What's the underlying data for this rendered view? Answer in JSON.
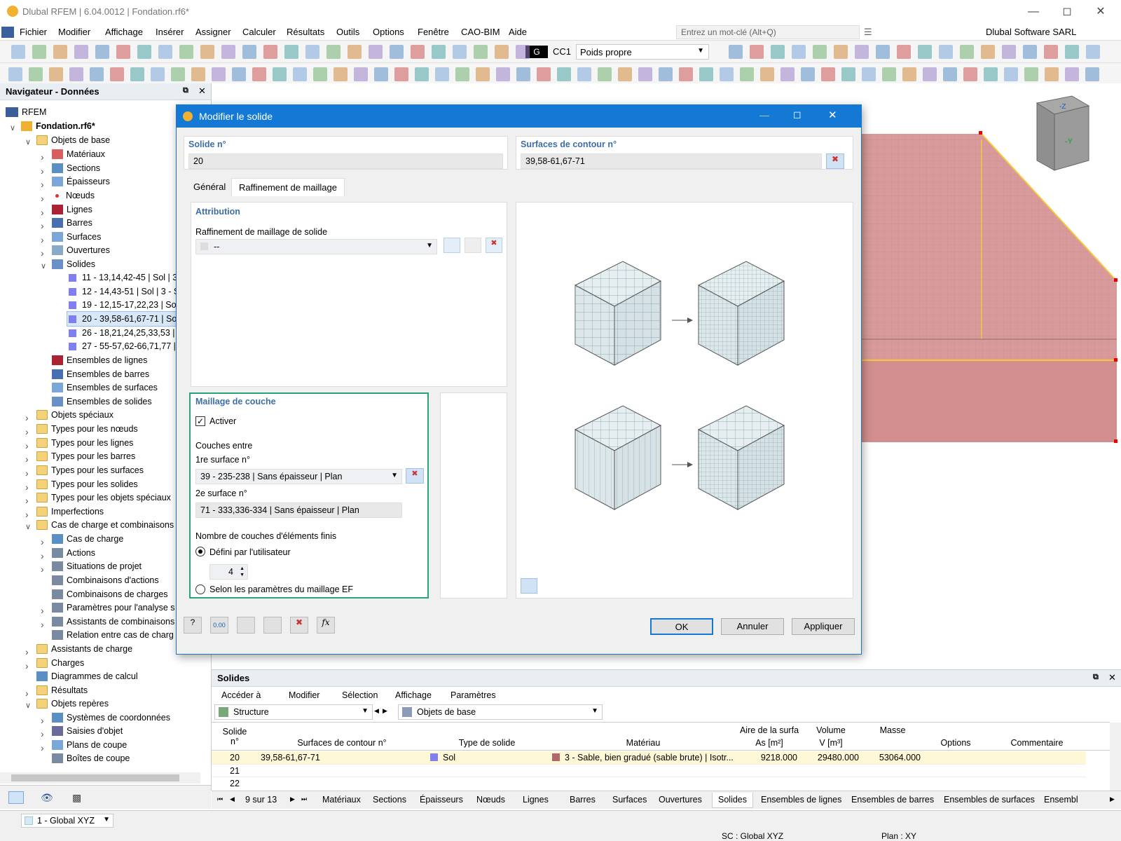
{
  "window": {
    "title": "Dlubal RFEM | 6.04.0012 | Fondation.rf6*",
    "company": "Dlubal Software SARL"
  },
  "menu": [
    "Fichier",
    "Modifier",
    "Affichage",
    "Insérer",
    "Assigner",
    "Calculer",
    "Résultats",
    "Outils",
    "Options",
    "Fenêtre",
    "CAO-BIM",
    "Aide"
  ],
  "search": {
    "placeholder": "Entrez un mot-clé (Alt+Q)"
  },
  "toolbar": {
    "lc_badge": "G",
    "lc_code": "CC1",
    "lc_name": "Poids propre"
  },
  "navigator": {
    "title": "Navigateur - Données",
    "root": "RFEM",
    "file": "Fondation.rf6*",
    "items": [
      "Objets de base",
      "Matériaux",
      "Sections",
      "Épaisseurs",
      "Nœuds",
      "Lignes",
      "Barres",
      "Surfaces",
      "Ouvertures",
      "Solides",
      "11 - 13,14,42-45 | Sol | 3",
      "12 - 14,43-51 | Sol | 3 - S",
      "19 - 12,15-17,22,23 | Sol",
      "20 - 39,58-61,67-71 | Sol",
      "26 - 18,21,24,25,33,53 | S",
      "27 - 55-57,62-66,71,77 | S",
      "Ensembles de lignes",
      "Ensembles de barres",
      "Ensembles de surfaces",
      "Ensembles de solides",
      "Objets spéciaux",
      "Types pour les nœuds",
      "Types pour les lignes",
      "Types pour les barres",
      "Types pour les surfaces",
      "Types pour les solides",
      "Types pour les objets spéciaux",
      "Imperfections",
      "Cas de charge et combinaisons",
      "Cas de charge",
      "Actions",
      "Situations de projet",
      "Combinaisons d'actions",
      "Combinaisons de charges",
      "Paramètres pour l'analyse s",
      "Assistants de combinaisons",
      "Relation entre cas de charg",
      "Assistants de charge",
      "Charges",
      "Diagrammes de calcul",
      "Résultats",
      "Objets repères",
      "Systèmes de coordonnées",
      "Saisies d'objet",
      "Plans de coupe",
      "Boîtes de coupe"
    ]
  },
  "viewcube": {
    "top": "-Z",
    "front": "-Y"
  },
  "dialog": {
    "title": "Modifier le solide",
    "solid_no_label": "Solide n°",
    "solid_no": "20",
    "boundary_label": "Surfaces de contour n°",
    "boundary": "39,58-61,67-71",
    "tabs": [
      "Général",
      "Raffinement de maillage"
    ],
    "attribution": "Attribution",
    "refinement_label": "Raffinement de maillage de solide",
    "refinement_value": "--",
    "layer_title": "Maillage de couche",
    "activate": "Activer",
    "layers_between": "Couches entre",
    "first_surface_label": "1re surface n°",
    "first_surface": "39 - 235-238 | Sans épaisseur | Plan",
    "second_surface_label": "2e surface n°",
    "second_surface": "71 - 333,336-334 | Sans épaisseur | Plan",
    "count_label": "Nombre de couches d'éléments finis",
    "user_defined": "Défini par l'utilisateur",
    "count": "4",
    "by_mesh": "Selon les paramètres du maillage EF",
    "ok": "OK",
    "cancel": "Annuler",
    "apply": "Appliquer"
  },
  "solids_panel": {
    "title": "Solides",
    "menu": [
      "Accéder à",
      "Modifier",
      "Sélection",
      "Affichage",
      "Paramètres"
    ],
    "filter1": "Structure",
    "filter2": "Objets de base",
    "headers": {
      "no": "Solide n°",
      "boundary": "Surfaces de contour n°",
      "type": "Type de solide",
      "material": "Matériau",
      "area": "Aire de la surfa",
      "area_unit": "As [m²]",
      "volume": "Volume",
      "volume_unit": "V [m³]",
      "mass": "Masse",
      "options": "Options",
      "comment": "Commentaire"
    },
    "rows": [
      {
        "no": "20",
        "boundary": "39,58-61,67-71",
        "type": "Sol",
        "material": "3 - Sable, bien gradué (sable brute) | Isotr...",
        "area": "9218.000",
        "volume": "29480.000",
        "mass": "53064.000"
      },
      {
        "no": "21"
      },
      {
        "no": "22"
      }
    ],
    "page": "9 sur 13",
    "tabs": [
      "Matériaux",
      "Sections",
      "Épaisseurs",
      "Nœuds",
      "Lignes",
      "Barres",
      "Surfaces",
      "Ouvertures",
      "Solides",
      "Ensembles de lignes",
      "Ensembles de barres",
      "Ensembles de surfaces",
      "Ensembl"
    ]
  },
  "status": {
    "cs": "1 - Global XYZ",
    "sc": "SC : Global XYZ",
    "plan": "Plan : XY"
  },
  "colors": {
    "accent": "#1479d4",
    "highlight_green": "#2aa37a",
    "model_red": "#d89a9a",
    "selection_yellow": "#f7c83c"
  }
}
